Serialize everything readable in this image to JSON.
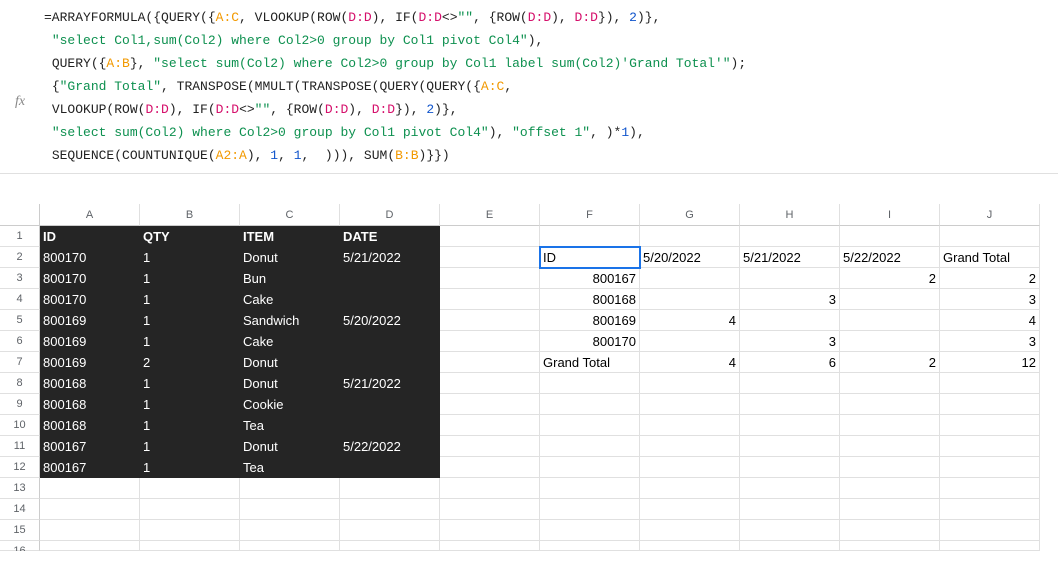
{
  "formula": {
    "l1a": "=ARRAYFORMULA({QUERY({",
    "l1b": "A:C",
    "l1c": ", VLOOKUP(ROW(",
    "l1d": "D:D",
    "l1e": "), IF(",
    "l1f": "D:D",
    "l1g": "<>",
    "l1h": "\"\"",
    "l1i": ", {ROW(",
    "l1j": "D:D",
    "l1k": "), ",
    "l1l": "D:D",
    "l1m": "}), ",
    "l1n": "2",
    "l1o": ")},",
    "l2a": "\"select Col1,sum(Col2) where Col2>0 group by Col1 pivot Col4\"",
    "l2b": "),",
    "l3a": "QUERY({",
    "l3b": "A:B",
    "l3c": "}, ",
    "l3d": "\"select sum(Col2) where Col2>0 group by Col1 label sum(Col2)'Grand Total'\"",
    "l3e": ");",
    "l4a": "{",
    "l4b": "\"Grand Total\"",
    "l4c": ", TRANSPOSE(MMULT(TRANSPOSE(QUERY(QUERY({",
    "l4d": "A:C",
    "l4e": ",",
    "l5a": "VLOOKUP(ROW(",
    "l5b": "D:D",
    "l5c": "), IF(",
    "l5d": "D:D",
    "l5e": "<>",
    "l5f": "\"\"",
    "l5g": ", {ROW(",
    "l5h": "D:D",
    "l5i": "), ",
    "l5j": "D:D",
    "l5k": "}), ",
    "l5l": "2",
    "l5m": ")},",
    "l6a": "\"select sum(Col2) where Col2>0 group by Col1 pivot Col4\"",
    "l6b": "), ",
    "l6c": "\"offset 1\"",
    "l6d": ", )*",
    "l6e": "1",
    "l6f": "),",
    "l7a": "SEQUENCE(COUNTUNIQUE(",
    "l7b": "A2:A",
    "l7c": "), ",
    "l7d": "1",
    "l7e": ", ",
    "l7f": "1",
    "l7g": ",  ))), SUM(",
    "l7h": "B:B",
    "l7i": ")}})"
  },
  "fx": "fx",
  "cols": [
    "A",
    "B",
    "C",
    "D",
    "E",
    "F",
    "G",
    "H",
    "I",
    "J"
  ],
  "rows": [
    "1",
    "2",
    "3",
    "4",
    "5",
    "6",
    "7",
    "8",
    "9",
    "10",
    "11",
    "12",
    "13",
    "14",
    "15",
    "16"
  ],
  "data_header": {
    "A": "ID",
    "B": "QTY",
    "C": "ITEM",
    "D": "DATE"
  },
  "data_rows": [
    {
      "A": "800170",
      "B": "1",
      "C": "Donut",
      "D": "5/21/2022"
    },
    {
      "A": "800170",
      "B": "1",
      "C": "Bun",
      "D": ""
    },
    {
      "A": "800170",
      "B": "1",
      "C": "Cake",
      "D": ""
    },
    {
      "A": "800169",
      "B": "1",
      "C": "Sandwich",
      "D": "5/20/2022"
    },
    {
      "A": "800169",
      "B": "1",
      "C": "Cake",
      "D": ""
    },
    {
      "A": "800169",
      "B": "2",
      "C": "Donut",
      "D": ""
    },
    {
      "A": "800168",
      "B": "1",
      "C": "Donut",
      "D": "5/21/2022"
    },
    {
      "A": "800168",
      "B": "1",
      "C": "Cookie",
      "D": ""
    },
    {
      "A": "800168",
      "B": "1",
      "C": "Tea",
      "D": ""
    },
    {
      "A": "800167",
      "B": "1",
      "C": "Donut",
      "D": "5/22/2022"
    },
    {
      "A": "800167",
      "B": "1",
      "C": "Tea",
      "D": ""
    }
  ],
  "pivot": {
    "r2": {
      "F": "ID",
      "G": "5/20/2022",
      "H": "5/21/2022",
      "I": "5/22/2022",
      "J": "Grand Total"
    },
    "r3": {
      "F": "800167",
      "G": "",
      "H": "",
      "I": "2",
      "J": "2"
    },
    "r4": {
      "F": "800168",
      "G": "",
      "H": "3",
      "I": "",
      "J": "3"
    },
    "r5": {
      "F": "800169",
      "G": "4",
      "H": "",
      "I": "",
      "J": "4"
    },
    "r6": {
      "F": "800170",
      "G": "",
      "H": "3",
      "I": "",
      "J": "3"
    },
    "r7": {
      "F": "Grand Total",
      "G": "4",
      "H": "6",
      "I": "2",
      "J": "12"
    }
  }
}
